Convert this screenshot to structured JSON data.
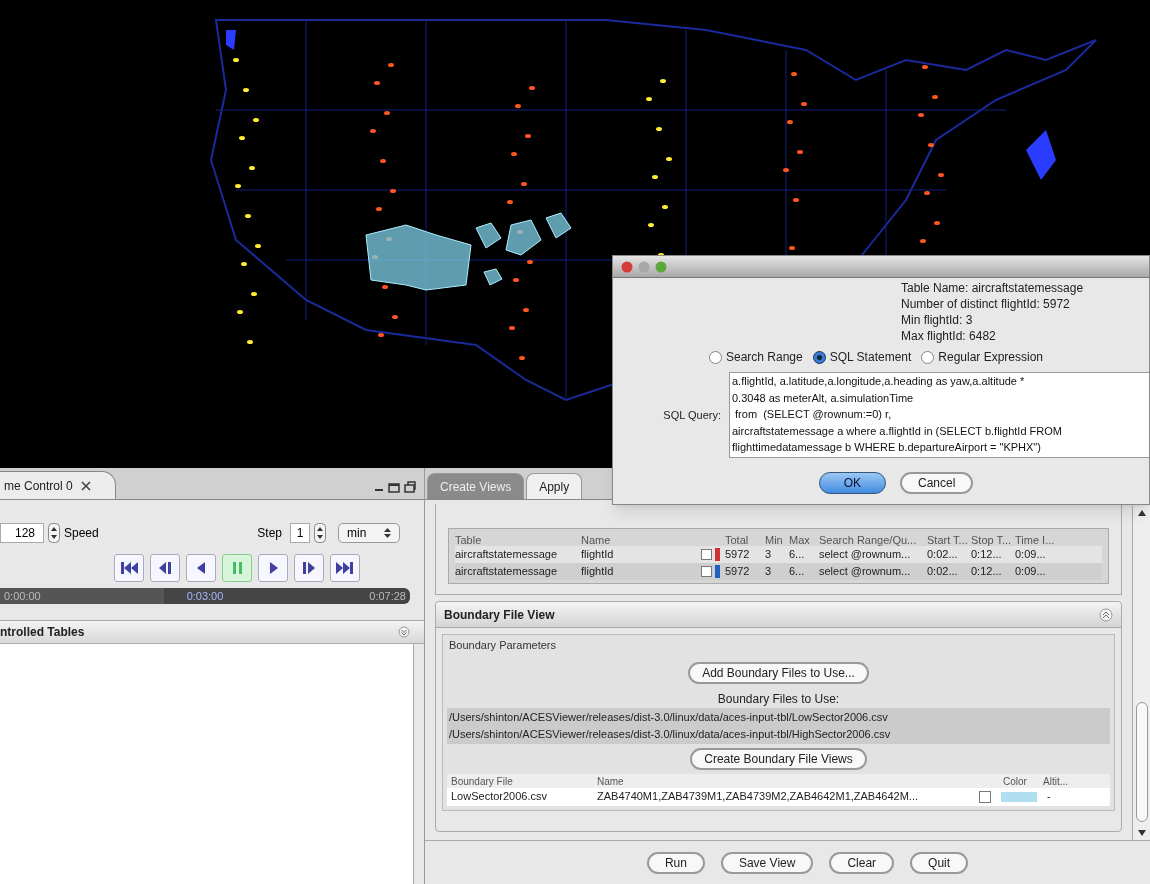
{
  "time_control": {
    "tab_title": "me Control 0",
    "speed_value": "128",
    "speed_label": "Speed",
    "step_label": "Step",
    "step_value": "1",
    "unit": "min",
    "transport": [
      {
        "kind": "first",
        "selected": false
      },
      {
        "kind": "step_back",
        "selected": false
      },
      {
        "kind": "back",
        "selected": false
      },
      {
        "kind": "pause",
        "selected": true
      },
      {
        "kind": "play",
        "selected": false
      },
      {
        "kind": "step_forward",
        "selected": false
      },
      {
        "kind": "last",
        "selected": false
      }
    ],
    "timeline": {
      "level": 0.4,
      "start": "0:00:00",
      "current": "0:03:00",
      "end": "0:07:28"
    },
    "tables_header": "ntrolled Tables"
  },
  "views": {
    "tabs": [
      {
        "label": "Create Views",
        "selected": true
      },
      {
        "label": "Apply",
        "selected": false
      }
    ],
    "columns": [
      "Table",
      "Name",
      "Total",
      "Min",
      "Max",
      "Search Range/Qu...",
      "Start T...",
      "Stop T...",
      "Time I..."
    ],
    "rows": [
      {
        "table": "aircraftstatemessage",
        "name": "flightId",
        "checked": false,
        "color": "#d03030",
        "total": "5972",
        "min": "3",
        "max": "6...",
        "search": "select @rownum...",
        "start": "0:02...",
        "stop": "0:12...",
        "time": "0:09..."
      },
      {
        "table": "aircraftstatemessage",
        "name": "flightId",
        "checked": false,
        "color": "#2060c0",
        "total": "5972",
        "min": "3",
        "max": "6...",
        "search": "select @rownum...",
        "start": "0:02...",
        "stop": "0:12...",
        "time": "0:09..."
      }
    ]
  },
  "boundary": {
    "title": "Boundary File View",
    "group_title": "Boundary Parameters",
    "add_button": "Add Boundary Files to Use...",
    "files_label": "Boundary Files to Use:",
    "files": [
      "/Users/shinton/ACESViewer/releases/dist-3.0/linux/data/aces-input-tbl/LowSector2006.csv",
      "/Users/shinton/ACESViewer/releases/dist-3.0/linux/data/aces-input-tbl/HighSector2006.csv"
    ],
    "create_button": "Create Boundary File Views",
    "columns": [
      "Boundary File",
      "Name",
      "Color",
      "Altit..."
    ],
    "rows": [
      {
        "file": "LowSector2006.csv",
        "names": "ZAB4740M1,ZAB4739M1,ZAB4739M2,ZAB4642M1,ZAB4642M...",
        "checked": false,
        "color": "#b0dff2",
        "altitude": "-"
      }
    ]
  },
  "buttons": [
    "Run",
    "Save View",
    "Clear",
    "Quit"
  ],
  "dialog": {
    "info": [
      "Table Name: aircraftstatemessage",
      "Number of distinct flightId: 5972",
      "Min flightId: 3",
      "Max flightId: 6482"
    ],
    "options": [
      {
        "label": "Search Range",
        "selected": false
      },
      {
        "label": "SQL Statement",
        "selected": true
      },
      {
        "label": "Regular Expression",
        "selected": false
      }
    ],
    "query_label": "SQL Query:",
    "query_lines": [
      "a.flightId, a.latitude,a.longitude,a.heading as yaw,a.altitude *",
      "0.3048 as meterAlt, a.simulationTime",
      " from  (SELECT @rownum:=0) r,",
      "aircraftstatemessage a where a.flightId in (SELECT b.flightId FROM",
      "flighttimedatamessage b WHERE b.departureAirport = \"KPHX\")"
    ],
    "ok": "OK",
    "cancel": "Cancel"
  }
}
